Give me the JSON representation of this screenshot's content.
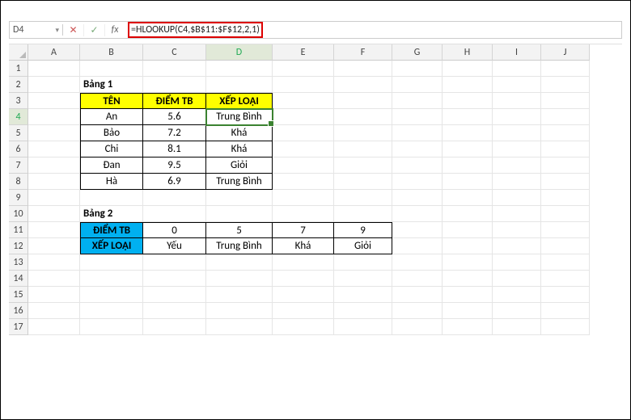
{
  "name_box": "D4",
  "formula": "=HLOOKUP(C4,$B$11:$F$12,2,1)",
  "columns": [
    "A",
    "B",
    "C",
    "D",
    "E",
    "F",
    "G",
    "H",
    "I",
    "J"
  ],
  "active_col": "D",
  "active_row": 4,
  "row_count": 17,
  "labels": {
    "table1_title": "Bảng 1",
    "table2_title": "Bảng 2",
    "col_ten": "TÊN",
    "col_diemtb": "ĐIỂM TB",
    "col_xeploai": "XẾP LOẠI"
  },
  "table1": [
    {
      "ten": "An",
      "diem": "5.6",
      "xl": "Trung Bình"
    },
    {
      "ten": "Bảo",
      "diem": "7.2",
      "xl": "Khá"
    },
    {
      "ten": "Chi",
      "diem": "8.1",
      "xl": "Khá"
    },
    {
      "ten": "Đan",
      "diem": "9.5",
      "xl": "Giỏi"
    },
    {
      "ten": "Hà",
      "diem": "6.9",
      "xl": "Trung Bình"
    }
  ],
  "table2": {
    "row1_label": "ĐIỂM TB",
    "row2_label": "XẾP LOẠI",
    "row1": [
      "0",
      "5",
      "7",
      "9"
    ],
    "row2": [
      "Yếu",
      "Trung Bình",
      "Khá",
      "Giỏi"
    ]
  },
  "icons": {
    "cancel": "✕",
    "confirm": "✓",
    "fx": "fx",
    "dropdown": "▾"
  }
}
